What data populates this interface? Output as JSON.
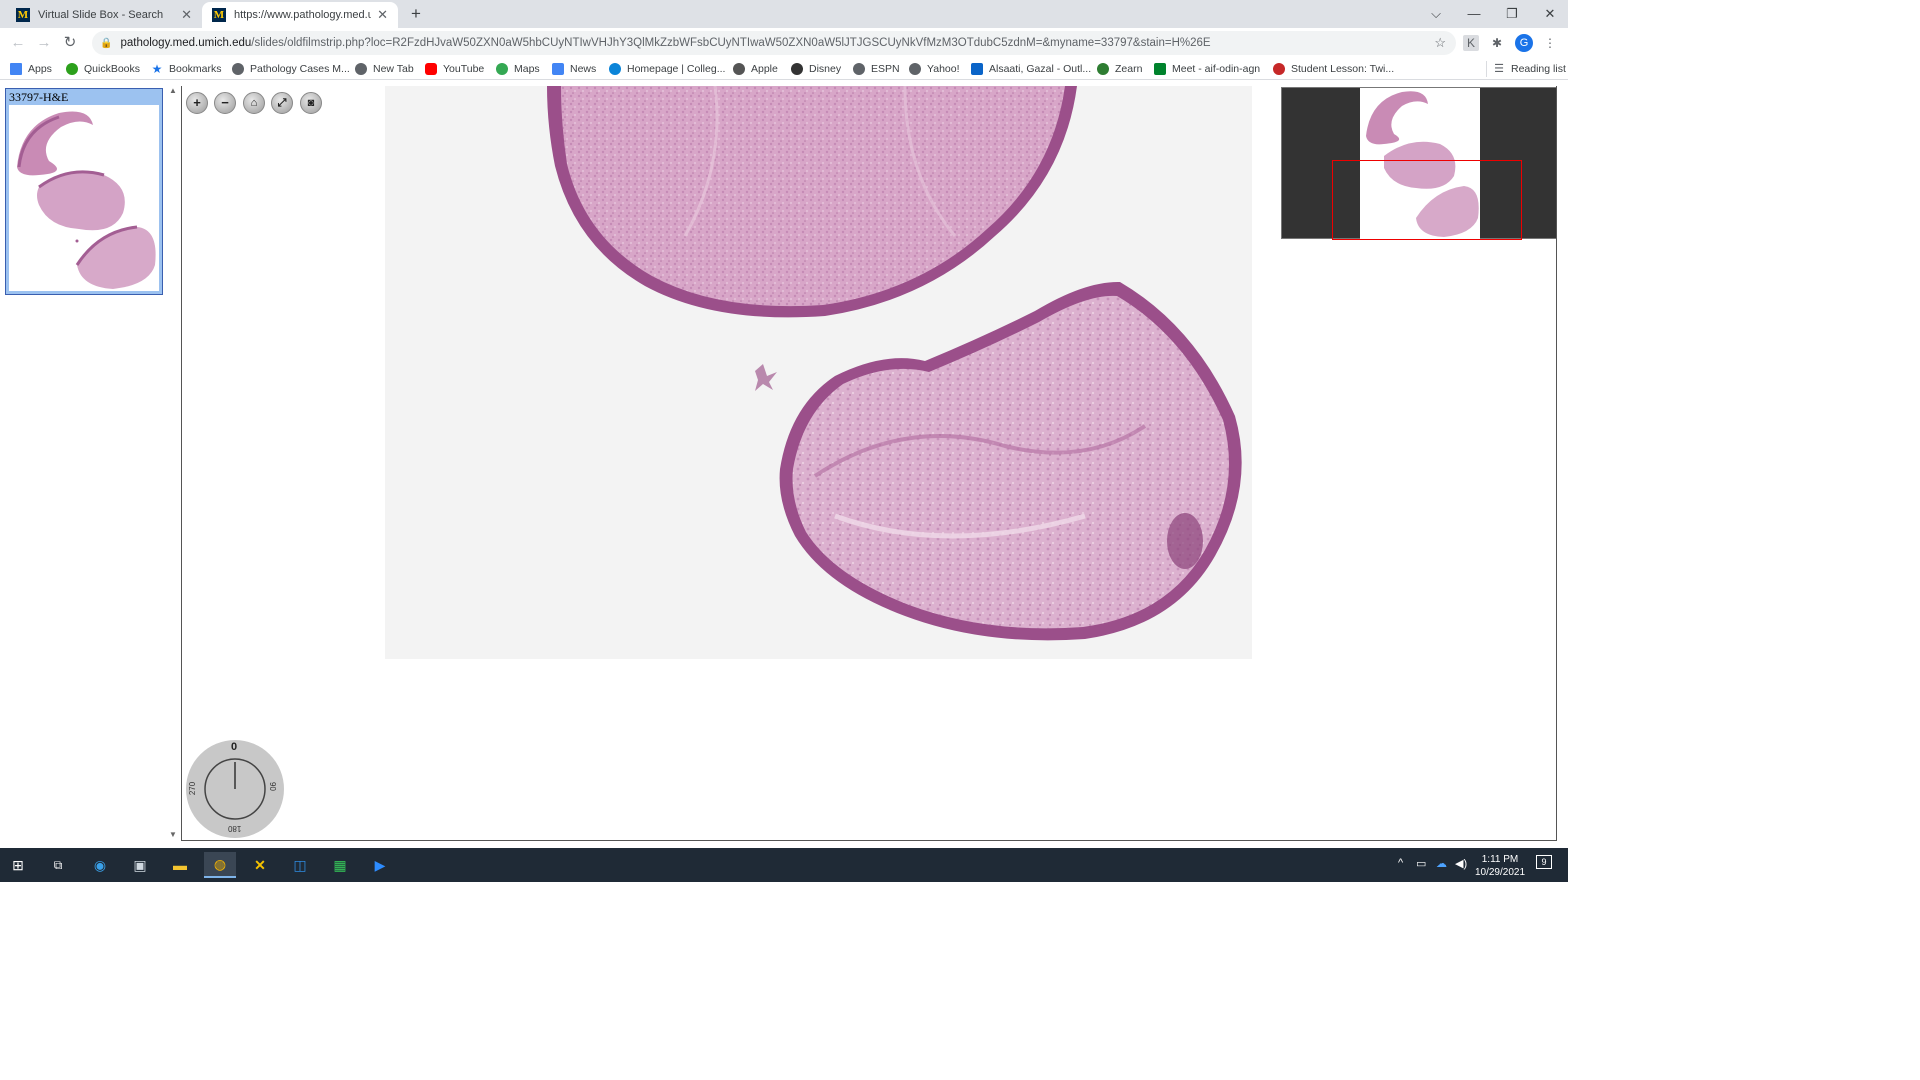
{
  "browser": {
    "tabs": [
      {
        "title": "Virtual Slide Box - Search",
        "favicon": "M"
      },
      {
        "title": "https://www.pathology.med.umi",
        "favicon": "M"
      }
    ],
    "new_tab_icon": "+",
    "url_host": "pathology.med.umich.edu",
    "url_path": "/slides/oldfilmstrip.php?loc=R2FzdHJvaW50ZXN0aW5hbCUyNTIwVHJhY3QlMkZzbWFsbCUyNTIwaW50ZXN0aW5lJTJGSCUyNkVfMzM3OTdubC5zdnM=&myname=33797&stain=H%26E",
    "profile_initial": "G"
  },
  "bookmarks": {
    "items": [
      {
        "label": "Apps",
        "icon": "apps-grid-icon",
        "color": "#4285f4"
      },
      {
        "label": "QuickBooks",
        "icon": "quickbooks-icon",
        "color": "#2ca01c"
      },
      {
        "label": "Bookmarks",
        "icon": "star-icon",
        "color": "#1a73e8"
      },
      {
        "label": "Pathology Cases M...",
        "icon": "globe-icon",
        "color": "#5f6368"
      },
      {
        "label": "New Tab",
        "icon": "globe-icon",
        "color": "#5f6368"
      },
      {
        "label": "YouTube",
        "icon": "youtube-icon",
        "color": "#ff0000"
      },
      {
        "label": "Maps",
        "icon": "maps-pin-icon",
        "color": "#34a853"
      },
      {
        "label": "News",
        "icon": "news-icon",
        "color": "#4285f4"
      },
      {
        "label": "Homepage | Colleg...",
        "icon": "college-icon",
        "color": "#0b84d8"
      },
      {
        "label": "Apple",
        "icon": "apple-icon",
        "color": "#555555"
      },
      {
        "label": "Disney",
        "icon": "disney-icon",
        "color": "#333333"
      },
      {
        "label": "ESPN",
        "icon": "globe-icon",
        "color": "#5f6368"
      },
      {
        "label": "Yahoo!",
        "icon": "globe-icon",
        "color": "#5f6368"
      },
      {
        "label": "Alsaati, Gazal - Outl...",
        "icon": "outlook-icon",
        "color": "#0a64c8"
      },
      {
        "label": "Zearn",
        "icon": "zearn-icon",
        "color": "#2e7d32"
      },
      {
        "label": "Meet - aif-odin-agn",
        "icon": "meet-icon",
        "color": "#00832d"
      },
      {
        "label": "Student Lesson: Twi...",
        "icon": "lesson-icon",
        "color": "#c62828"
      }
    ],
    "reading_list": "Reading list"
  },
  "viewer": {
    "slide_label": "33797-H&E",
    "rotation": {
      "top": "0",
      "right": "90",
      "bottom": "180",
      "left": "270"
    }
  },
  "taskbar": {
    "time": "1:11 PM",
    "date": "10/29/2021",
    "notifications": "9"
  }
}
